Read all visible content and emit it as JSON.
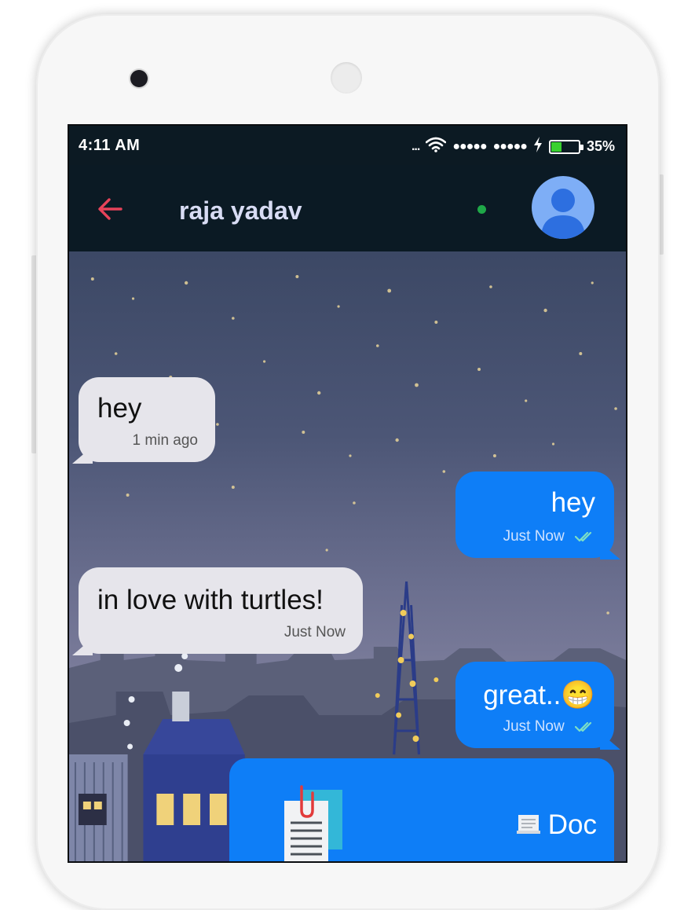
{
  "status_bar": {
    "time": "4:11 AM",
    "signal_1": "●●●●●",
    "signal_2": "●●●●●",
    "overflow": "...",
    "battery_percent": "35%",
    "battery_level": 0.35,
    "icons": [
      "wifi-icon",
      "charging-icon",
      "battery-icon"
    ]
  },
  "header": {
    "title": "raja yadav",
    "back_icon": "arrow-left-icon",
    "avatar_icon": "person-icon",
    "online_status_color": "#1fa848"
  },
  "messages": [
    {
      "direction": "incoming",
      "text": "hey",
      "time": "1 min ago"
    },
    {
      "direction": "outgoing",
      "text": "hey",
      "time": "Just Now",
      "read_receipt": "double-check-icon"
    },
    {
      "direction": "incoming",
      "text": "in love with turtles!",
      "time": "Just Now"
    },
    {
      "direction": "outgoing",
      "text": "great..😁",
      "time": "Just Now",
      "read_receipt": "double-check-icon"
    },
    {
      "direction": "outgoing",
      "type": "document",
      "label": "Doc",
      "icon": "document-icon",
      "label_icon": "page-icon"
    }
  ],
  "colors": {
    "accent_back": "#e6435a",
    "bubble_outgoing": "#0e7ef7",
    "bubble_incoming": "#e6e5eb",
    "header_bg": "#0b1a24",
    "title": "#d8dcf4"
  }
}
